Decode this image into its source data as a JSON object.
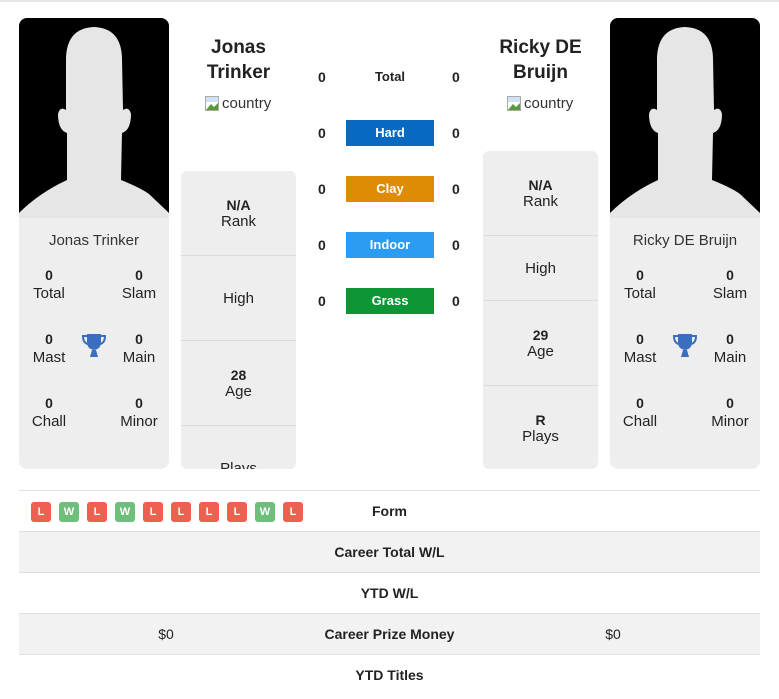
{
  "colors": {
    "hard": "#0869c1",
    "clay": "#de8b05",
    "indoor": "#2c9bf2",
    "grass": "#0c9636",
    "loss": "#ee6150",
    "win": "#6dbf7b",
    "trophy": "#3a6fc0"
  },
  "player1": {
    "name_line1": "Jonas",
    "name_line2": "Trinker",
    "full_name": "Jonas Trinker",
    "flag_alt": "country",
    "titles": {
      "total": {
        "value": "0",
        "label": "Total"
      },
      "slam": {
        "value": "0",
        "label": "Slam"
      },
      "mast": {
        "value": "0",
        "label": "Mast"
      },
      "main": {
        "value": "0",
        "label": "Main"
      },
      "chall": {
        "value": "0",
        "label": "Chall"
      },
      "minor": {
        "value": "0",
        "label": "Minor"
      }
    },
    "info": {
      "rank": {
        "value": "N/A",
        "label": "Rank"
      },
      "high": {
        "value": "",
        "label": "High"
      },
      "age": {
        "value": "28",
        "label": "Age"
      },
      "plays": {
        "value": "",
        "label": "Plays"
      }
    }
  },
  "player2": {
    "name_line1": "Ricky DE",
    "name_line2": "Bruijn",
    "full_name": "Ricky DE Bruijn",
    "flag_alt": "country",
    "titles": {
      "total": {
        "value": "0",
        "label": "Total"
      },
      "slam": {
        "value": "0",
        "label": "Slam"
      },
      "mast": {
        "value": "0",
        "label": "Mast"
      },
      "main": {
        "value": "0",
        "label": "Main"
      },
      "chall": {
        "value": "0",
        "label": "Chall"
      },
      "minor": {
        "value": "0",
        "label": "Minor"
      }
    },
    "info": {
      "rank": {
        "value": "N/A",
        "label": "Rank"
      },
      "high": {
        "value": "",
        "label": "High"
      },
      "age": {
        "value": "29",
        "label": "Age"
      },
      "plays": {
        "value": "R",
        "label": "Plays"
      }
    }
  },
  "surfaces": [
    {
      "label": "Total",
      "left": "0",
      "right": "0"
    },
    {
      "label": "Hard",
      "left": "0",
      "right": "0"
    },
    {
      "label": "Clay",
      "left": "0",
      "right": "0"
    },
    {
      "label": "Indoor",
      "left": "0",
      "right": "0"
    },
    {
      "label": "Grass",
      "left": "0",
      "right": "0"
    }
  ],
  "table": {
    "form_label": "Form",
    "form": [
      "L",
      "W",
      "L",
      "W",
      "L",
      "L",
      "L",
      "L",
      "W",
      "L"
    ],
    "rows": [
      {
        "label": "Career Total W/L",
        "left": "",
        "right": ""
      },
      {
        "label": "YTD W/L",
        "left": "",
        "right": ""
      },
      {
        "label": "Career Prize Money",
        "left": "$0",
        "right": "$0"
      },
      {
        "label": "YTD Titles",
        "left": "",
        "right": ""
      }
    ]
  }
}
